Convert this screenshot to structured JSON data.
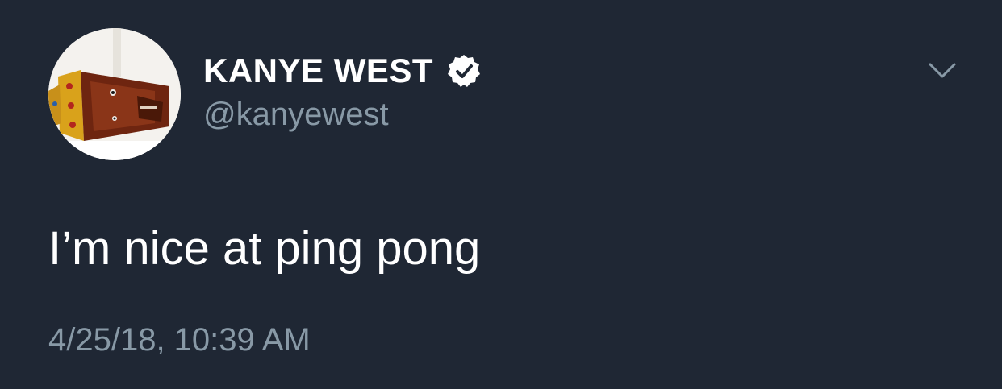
{
  "author": {
    "display_name": "KANYE WEST",
    "handle": "@kanyewest",
    "verified": true,
    "avatar_icon": "avatar-kanye-crown-image"
  },
  "tweet": {
    "text": "I’m nice at ping pong",
    "timestamp": "4/25/18, 10:39 AM"
  },
  "icons": {
    "verified": "verified-badge-icon",
    "menu": "chevron-down-icon"
  },
  "colors": {
    "background": "#1f2734",
    "primary_text": "#ffffff",
    "secondary_text": "#8899a6"
  }
}
